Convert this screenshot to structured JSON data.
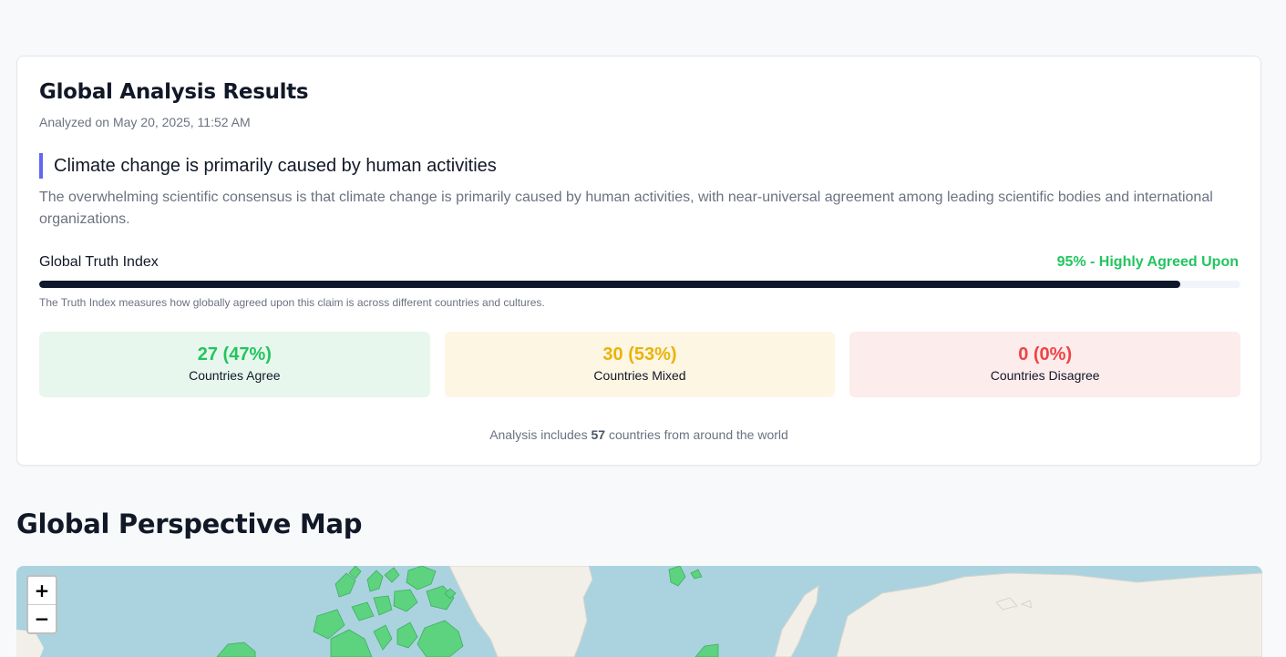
{
  "results": {
    "title": "Global Analysis Results",
    "analyzed_on": "Analyzed on May 20, 2025, 11:52 AM",
    "claim": "Climate change is primarily caused by human activities",
    "description": "The overwhelming scientific consensus is that climate change is primarily caused by human activities, with near-universal agreement among leading scientific bodies and international organizations.",
    "truth_index": {
      "label": "Global Truth Index",
      "value_text": "95% - Highly Agreed Upon",
      "percent": 95,
      "note": "The Truth Index measures how globally agreed upon this claim is across different countries and cultures."
    },
    "stats": [
      {
        "value": "27 (47%)",
        "label": "Countries Agree",
        "color": "#22c55e"
      },
      {
        "value": "30 (53%)",
        "label": "Countries Mixed",
        "color": "#eab308"
      },
      {
        "value": "0 (0%)",
        "label": "Countries Disagree",
        "color": "#ef4444"
      }
    ],
    "summary": {
      "prefix": "Analysis includes",
      "count": "57",
      "suffix": "countries from around the world"
    }
  },
  "map_section": {
    "title": "Global Perspective Map",
    "zoom_in": "+",
    "zoom_out": "−",
    "colors": {
      "water": "#aad3df",
      "land": "#f2efe9",
      "agree": "#5dd27f"
    }
  },
  "colors": {
    "accent": "#6366f1",
    "bar_fill": "#0f172a"
  }
}
